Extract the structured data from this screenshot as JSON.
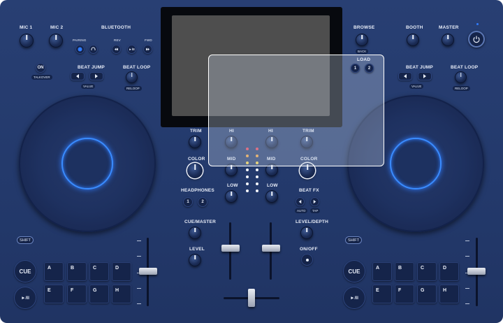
{
  "left_top": {
    "mic1": "MIC 1",
    "mic2": "MIC 2",
    "bluetooth": "BLUETOOTH",
    "pairing": "PAIRING",
    "rev": "REV",
    "fwd": "FWD",
    "play_pause": "►/II",
    "on": "ON",
    "talkover": "TALKOVER",
    "beat_jump": "BEAT JUMP",
    "value": "VALUE",
    "beat_loop": "BEAT LOOP",
    "reloop": "RELOOP"
  },
  "right_top": {
    "browse": "BROWSE",
    "back": "BACK",
    "booth": "BOOTH",
    "master": "MASTER",
    "load": "LOAD",
    "load_1": "1",
    "load_2": "2",
    "beat_jump": "BEAT JUMP",
    "value": "VALUE",
    "beat_loop": "BEAT LOOP",
    "reloop": "RELOOP"
  },
  "mixer": {
    "trim_left": "TRIM",
    "trim_right": "TRIM",
    "hi_left": "HI",
    "hi_right": "HI",
    "mid_left": "MID",
    "mid_right": "MID",
    "low_left": "LOW",
    "low_right": "LOW",
    "color_left": "COLOR",
    "color_right": "COLOR",
    "headphones": "HEADPHONES",
    "hp_1": "1",
    "hp_2": "2",
    "beat_fx": "BEAT FX",
    "auto": "AUTO",
    "tap": "TAP",
    "cue_master": "CUE/MASTER",
    "level": "LEVEL",
    "level_depth": "LEVEL/DEPTH",
    "on_off": "ON/OFF"
  },
  "deck_left": {
    "shift": "SHIFT",
    "cue": "CUE",
    "play": "►/II",
    "pads": [
      "A",
      "B",
      "C",
      "D",
      "E",
      "F",
      "G",
      "H"
    ]
  },
  "deck_right": {
    "shift": "SHIFT",
    "cue": "CUE",
    "play": "►/II",
    "pads": [
      "A",
      "B",
      "C",
      "D",
      "E",
      "F",
      "G",
      "H"
    ]
  },
  "colors": {
    "body": "#23396b",
    "jog_ring": "#3a8cff",
    "screen": "#4e4e4e",
    "led_red": "#e5455a",
    "led_orange": "#f2a541",
    "led_yellow": "#f5d34a",
    "led_white": "#f4f6fb"
  },
  "icons": [
    "power-icon",
    "headphones-icon",
    "bluetooth-icon",
    "play-pause-icon",
    "arrow-left-icon",
    "arrow-right-icon",
    "rewind-icon",
    "forward-icon"
  ]
}
